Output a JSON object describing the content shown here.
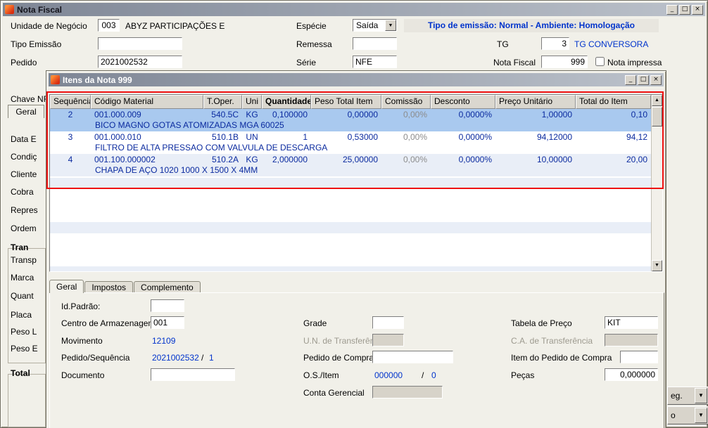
{
  "icons": {
    "minimize": "_",
    "restore": "□",
    "close": "×",
    "dropdown": "▼",
    "scroll_up": "▲",
    "scroll_down": "▼"
  },
  "window": {
    "title": "Nota Fiscal"
  },
  "form": {
    "unidade_label": "Unidade de Negócio",
    "unidade_code": "003",
    "unidade_name": "ABYZ PARTICIPAÇÕES E",
    "especie_label": "Espécie",
    "especie_value": "Saída",
    "banner": "Tipo de emissão: Normal - Ambiente: Homologação",
    "tipo_emissao_label": "Tipo Emissão",
    "remessa_label": "Remessa",
    "tg_label": "TG",
    "tg_value": "3",
    "tg_name": "TG CONVERSORA",
    "pedido_label": "Pedido",
    "pedido_value": "2021002532",
    "serie_label": "Série",
    "serie_value": "NFE",
    "nota_label": "Nota Fiscal",
    "nota_value": "999",
    "impressa_label": "Nota impressa",
    "chave_label": "Chave NF"
  },
  "left_panel": {
    "labels": [
      "Geral",
      "Data E",
      "Condiç",
      "Cliente",
      "Cobra",
      "Repres",
      "Ordem",
      "Tran",
      "Transp",
      "Marca",
      "Quant",
      "Placa",
      "Peso L",
      "Peso E",
      "Total"
    ]
  },
  "bottom_buttons": {
    "b1": "eg.",
    "b2": "o"
  },
  "items_window": {
    "title": "Itens da Nota 999",
    "grid": {
      "columns": [
        "Sequência",
        "Código Material",
        "T.Oper.",
        "Uni",
        "Quantidade",
        "Peso Total Item",
        "Comissão",
        "Desconto",
        "Preço Unitário",
        "Total do Item"
      ],
      "rows": [
        {
          "seq": "2",
          "codigo": "001.000.009",
          "toper": "540.5C",
          "uni": "KG",
          "qtd": "0,100000",
          "peso": "0,00000",
          "com": "0,00%",
          "desc": "0,0000%",
          "preco": "1,00000",
          "total": "0,10",
          "descricao": "BICO MAGNO GOTAS ATOMIZADAS MGA 60025"
        },
        {
          "seq": "3",
          "codigo": "001.000.010",
          "toper": "510.1B",
          "uni": "UN",
          "qtd": "1",
          "peso": "0,53000",
          "com": "0,00%",
          "desc": "0,0000%",
          "preco": "94,12000",
          "total": "94,12",
          "descricao": "FILTRO DE ALTA PRESSAO COM VALVULA DE DESCARGA"
        },
        {
          "seq": "4",
          "codigo": "001.100.000002",
          "toper": "510.2A",
          "uni": "KG",
          "qtd": "2,000000",
          "peso": "25,00000",
          "com": "0,00%",
          "desc": "0,0000%",
          "preco": "10,00000",
          "total": "20,00",
          "descricao": "CHAPA DE AÇO 1020 1000 X 1500  X 4MM"
        }
      ]
    },
    "tabs": [
      "Geral",
      "Impostos",
      "Complemento"
    ],
    "panel": {
      "id_padrao_label": "Id.Padrão:",
      "centro_label": "Centro de Armazenagem",
      "centro_value": "001",
      "movimento_label": "Movimento",
      "movimento_value": "12109",
      "pedido_seq_label": "Pedido/Sequência",
      "pedido_seq_value": "2021002532",
      "pedido_seq_sep": "/",
      "pedido_seq_num": "1",
      "documento_label": "Documento",
      "grade_label": "Grade",
      "un_transf_label": "U.N. de Transferência",
      "pedido_compra_label": "Pedido de Compra",
      "os_label": "O.S./Item",
      "os_value": "000000",
      "os_sep": "/",
      "os_num": "0",
      "conta_label": "Conta Gerencial",
      "tabela_label": "Tabela de Preço",
      "tabela_value": "KIT",
      "ca_transf_label": "C.A. de Transferência",
      "item_pedido_label": "Item do Pedido de Compra",
      "pecas_label": "Peças",
      "pecas_value": "0,000000"
    }
  }
}
